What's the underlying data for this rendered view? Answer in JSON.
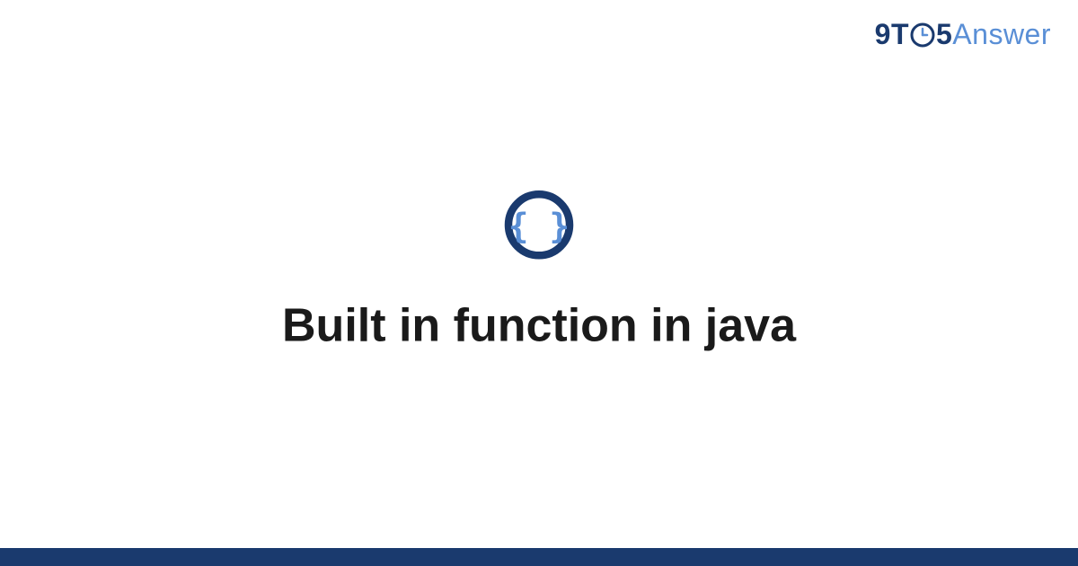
{
  "brand": {
    "part1": "9T",
    "part2": "5",
    "part3": "Answer"
  },
  "colors": {
    "dark_blue": "#1a3a6e",
    "light_blue": "#5a8fd6",
    "brace_blue": "#5a8fd6",
    "ring_blue": "#1a3a6e"
  },
  "icon": {
    "name": "code-braces-icon"
  },
  "title": "Built in function in java"
}
